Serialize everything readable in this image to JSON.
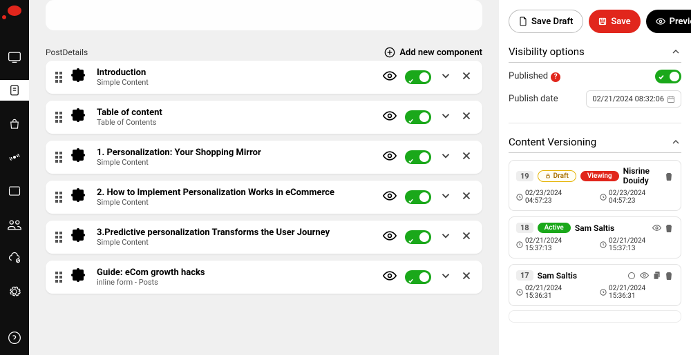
{
  "section": {
    "title": "PostDetails",
    "add_label": "Add new component"
  },
  "rows": [
    {
      "title": "Introduction",
      "subtitle": "Simple Content"
    },
    {
      "title": "Table of content",
      "subtitle": "Table of Contents"
    },
    {
      "title": "1. Personalization: Your Shopping Mirror",
      "subtitle": "Simple Content"
    },
    {
      "title": "2. How to Implement Personalization Works in eCommerce",
      "subtitle": "Simple Content"
    },
    {
      "title": "3.Predictive personalization Transforms the User Journey",
      "subtitle": "Simple Content"
    },
    {
      "title": "Guide: eCom growth hacks",
      "subtitle": "inline form - Posts"
    }
  ],
  "topbar": {
    "save_draft": "Save Draft",
    "save": "Save",
    "preview": "Preview"
  },
  "visibility": {
    "heading": "Visibility options",
    "published_label": "Published",
    "date_label": "Publish date",
    "date_value": "02/21/2024 08:32:06"
  },
  "versioning": {
    "heading": "Content Versioning",
    "items": [
      {
        "num": "19",
        "badges": [
          "draft",
          "viewing"
        ],
        "author": "Nisrine Douidy",
        "t1": "02/23/2024 04:57:23",
        "t2": "02/23/2024 04:57:23",
        "actions": [
          "trash"
        ]
      },
      {
        "num": "18",
        "badges": [
          "active"
        ],
        "author": "Sam Saltis",
        "t1": "02/21/2024 15:37:13",
        "t2": "02/21/2024 15:37:13",
        "actions": [
          "eye",
          "trash"
        ]
      },
      {
        "num": "17",
        "badges": [],
        "author": "Sam Saltis",
        "t1": "02/21/2024 15:36:31",
        "t2": "02/21/2024 15:36:31",
        "actions": [
          "circle",
          "eye",
          "copy",
          "trash"
        ]
      }
    ]
  },
  "badges": {
    "draft": "Draft",
    "viewing": "Viewing",
    "active": "Active"
  }
}
